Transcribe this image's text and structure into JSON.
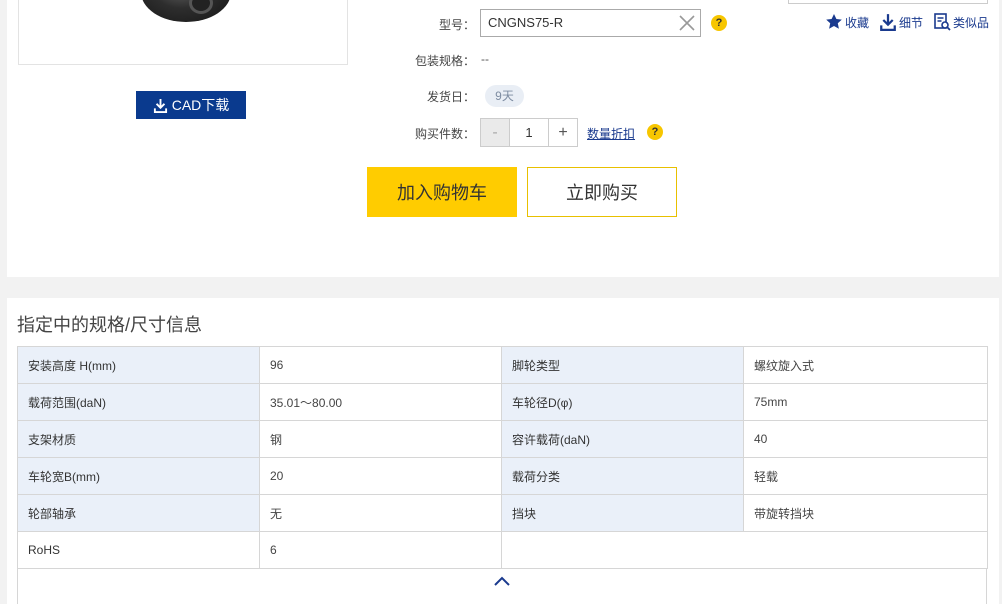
{
  "product": {
    "cad_label": "CAD下载",
    "model_label": "型号：",
    "model_value": "CNGNS75-R",
    "help_glyph": "?",
    "package_label": "包装规格：",
    "package_value": "--",
    "ship_label": "发货日：",
    "ship_value": "9天",
    "qty_label": "购买件数：",
    "qty_value": "1",
    "qty_minus": "-",
    "qty_plus": "+",
    "discount_link": "数量折扣",
    "add_cart": "加入购物车",
    "buy_now": "立即购买"
  },
  "actions": {
    "favorite": "收藏",
    "detail": "细节",
    "similar": "类似品"
  },
  "specs": {
    "title": "指定中的规格/尺寸信息",
    "rows": [
      [
        "安装高度 H(mm)",
        "96",
        "脚轮类型",
        "螺纹旋入式"
      ],
      [
        "载荷范围(daN)",
        "35.01～80.00",
        "车轮径D(φ)",
        "75mm"
      ],
      [
        "支架材质",
        "钢",
        "容许载荷(daN)",
        "40"
      ],
      [
        "车轮宽B(mm)",
        "20",
        "载荷分类",
        "轻载"
      ],
      [
        "轮部轴承",
        "无",
        "挡块",
        "带旋转挡块"
      ],
      [
        "RoHS",
        "6",
        "",
        ""
      ]
    ]
  },
  "colors": {
    "accent_yellow": "#ffcc00",
    "brand_blue": "#0a3a8e",
    "key_cell_bg": "#eaf0f9"
  }
}
